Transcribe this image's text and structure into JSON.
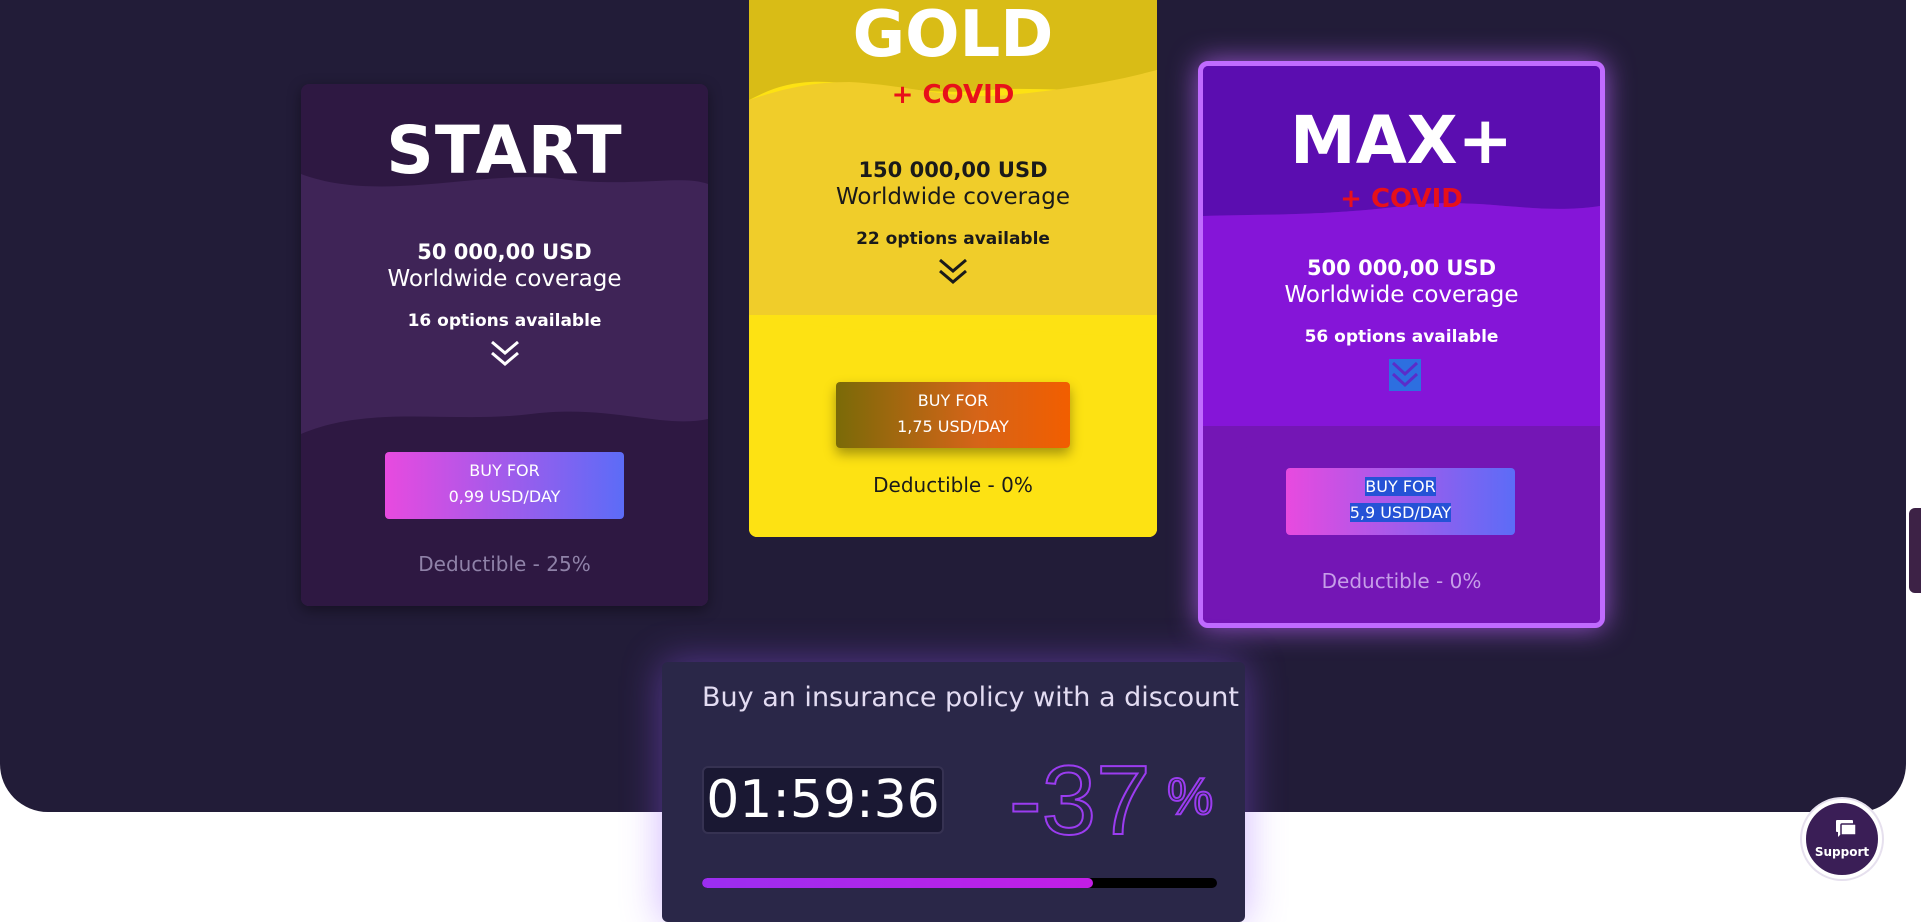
{
  "plans": {
    "start": {
      "title": "START",
      "amount": "50 000,00 USD",
      "coverage": "Worldwide coverage",
      "options": "16 options available",
      "buy_line1": "BUY FOR",
      "buy_line2": "0,99 USD/DAY",
      "deductible": "Deductible - 25%"
    },
    "gold": {
      "title": "GOLD",
      "covid": "+ COVID",
      "amount": "150 000,00 USD",
      "coverage": "Worldwide coverage",
      "options": "22 options available",
      "buy_line1": "BUY FOR",
      "buy_line2": "1,75 USD/DAY",
      "deductible": "Deductible - 0%"
    },
    "max": {
      "title": "MAX+",
      "covid": "+ COVID",
      "amount": "500 000,00 USD",
      "coverage": "Worldwide coverage",
      "options": "56 options available",
      "buy_line1": "BUY FOR",
      "buy_line2": "5,9 USD/DAY",
      "deductible": "Deductible - 0%"
    }
  },
  "discount": {
    "heading": "Buy an insurance policy with a discount",
    "timer": "01:59:36",
    "percent": "-37",
    "percent_sign": "%",
    "progress_fraction": 0.76
  },
  "support": {
    "label": "Support",
    "icon": "chat-icon"
  },
  "colors": {
    "hero_bg": "#221c38",
    "start_card": "#2e1842",
    "gold_card": "#fde213",
    "max_card": "#7416b5",
    "covid_red": "#e8101a",
    "accent_purple": "#9b2ef0"
  }
}
